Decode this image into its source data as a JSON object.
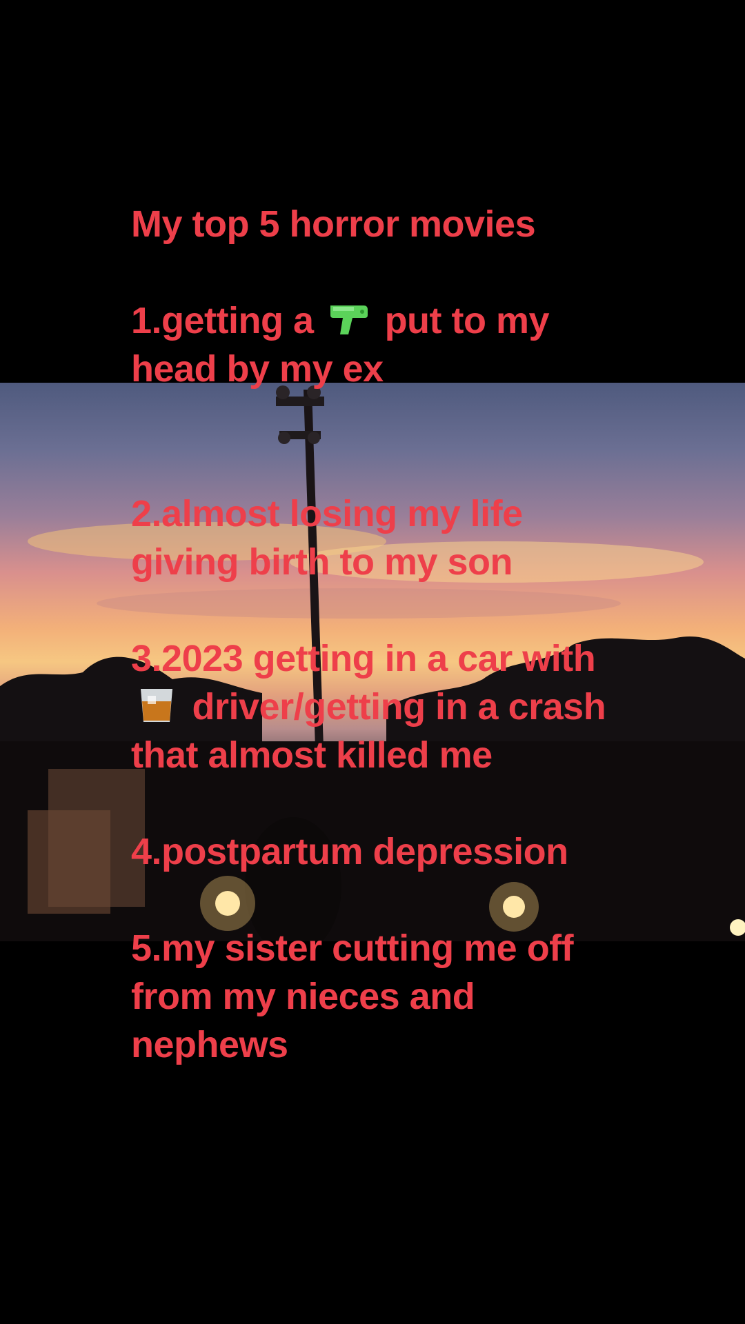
{
  "overlay_text": {
    "title": "My top 5 horror movies",
    "item1_before": "1.getting a",
    "item1_after": "put to my head by my ex",
    "item2": "2.almost losing my life giving birth to my son",
    "item3_before": "3.2023 getting in a car with",
    "item3_after": "driver/getting in a crash that almost killed me",
    "item4": "4.postpartum depression",
    "item5": "5.my sister cutting me off from my nieces and nephews"
  },
  "icons": {
    "item1_emoji": "water-pistol-icon",
    "item3_emoji": "tumbler-glass-icon"
  },
  "colors": {
    "text": "#ee3f4a",
    "background": "#000000"
  }
}
